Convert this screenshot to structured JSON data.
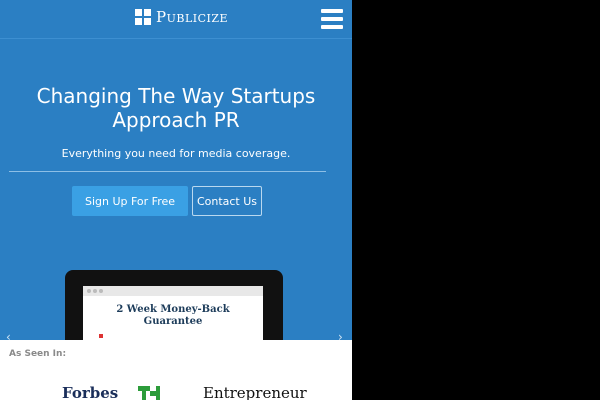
{
  "header": {
    "logo_text": "Publicize",
    "menu_icon": "hamburger-menu-icon"
  },
  "hero": {
    "title_line1": "Changing The Way Startups",
    "title_line2": "Approach PR",
    "subtitle": "Everything you need for media coverage.",
    "primary_button": "Sign Up For Free",
    "secondary_button": "Contact Us"
  },
  "slider": {
    "screen_headline_line1": "2 Week Money-Back",
    "screen_headline_line2": "Guarantee",
    "prev_icon": "chevron-left-icon",
    "next_icon": "chevron-right-icon"
  },
  "press": {
    "label": "As Seen In:",
    "logos": [
      "Forbes",
      "TechCrunch",
      "Entrepreneur"
    ],
    "forbes_text": "Forbes",
    "entrepreneur_text": "Entrepreneur"
  },
  "colors": {
    "hero_bg": "#2b7fc3",
    "primary_button": "#3aa0e4",
    "outer_bg": "#000000"
  }
}
